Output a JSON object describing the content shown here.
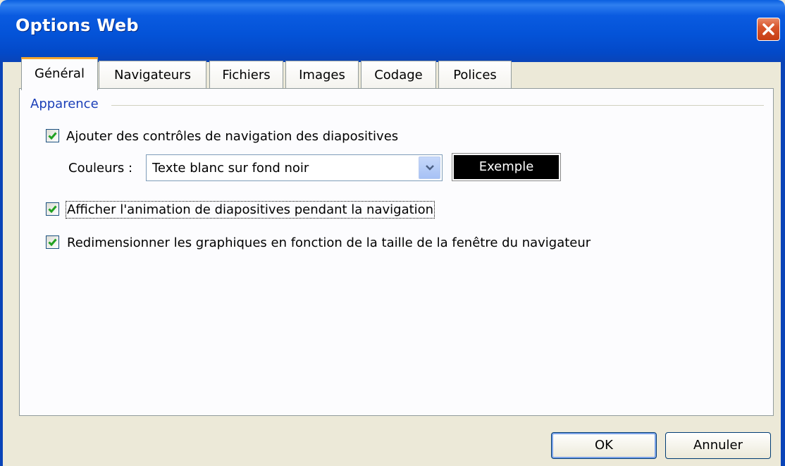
{
  "window": {
    "title": "Options Web"
  },
  "tabs": [
    {
      "label": "Général",
      "active": true
    },
    {
      "label": "Navigateurs",
      "active": false
    },
    {
      "label": "Fichiers",
      "active": false
    },
    {
      "label": "Images",
      "active": false
    },
    {
      "label": "Codage",
      "active": false
    },
    {
      "label": "Polices",
      "active": false
    }
  ],
  "appearance": {
    "group_label": "Apparence",
    "nav_controls": {
      "label": "Ajouter des contrôles de navigation des diapositives",
      "checked": true
    },
    "colors": {
      "label": "Couleurs :",
      "value": "Texte blanc sur fond noir",
      "sample": "Exemple"
    },
    "show_animation": {
      "label": "Afficher l'animation de diapositives pendant la navigation",
      "checked": true
    },
    "resize_graphics": {
      "label": "Redimensionner les graphiques en fonction de la taille de la fenêtre du navigateur",
      "checked": true
    }
  },
  "buttons": {
    "ok": "OK",
    "cancel": "Annuler"
  },
  "colors": {
    "title_bar": "#0453d8",
    "accent_tab": "#f5a630",
    "group_label": "#1b3fb8",
    "check": "#21a121",
    "close": "#c63d14"
  }
}
